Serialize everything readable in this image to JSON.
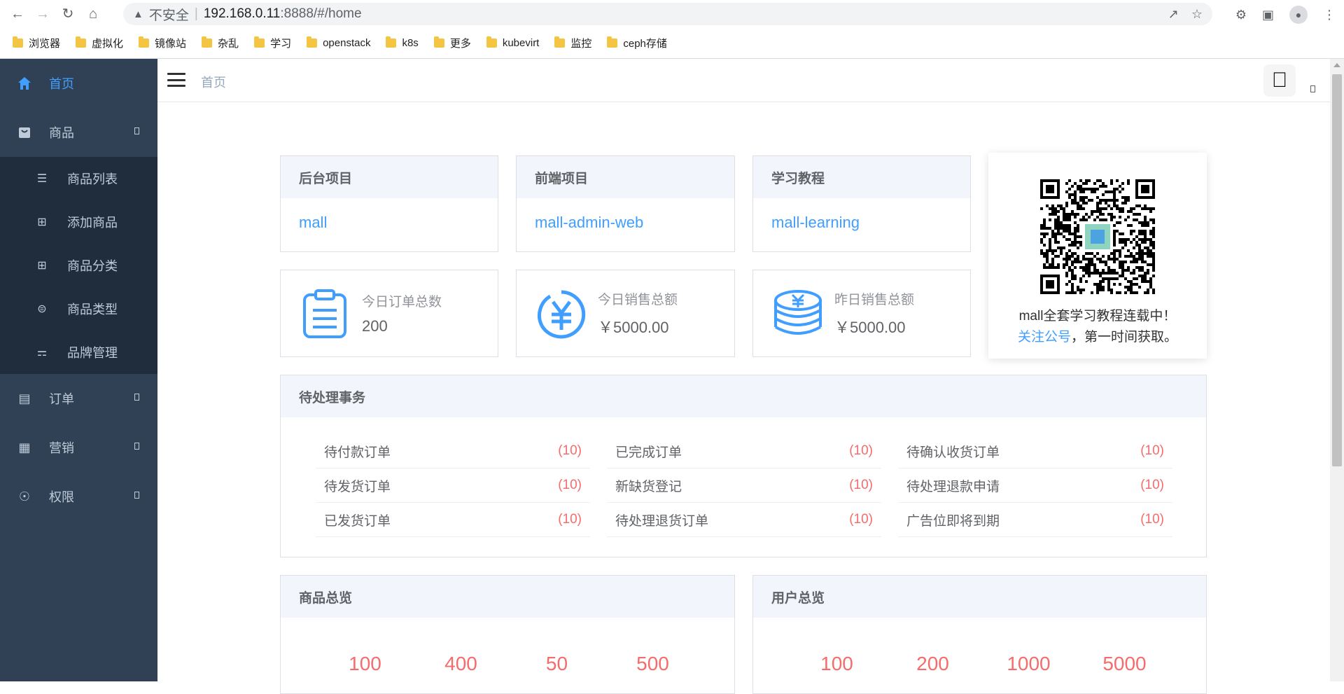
{
  "browser": {
    "insecure_label": "不安全",
    "url_host": "192.168.0.11",
    "url_rest": ":8888/#/home",
    "bookmarks": [
      "浏览器",
      "虚拟化",
      "镜像站",
      "杂乱",
      "学习",
      "openstack",
      "k8s",
      "更多",
      "kubevirt",
      "监控",
      "ceph存储"
    ]
  },
  "sidebar": {
    "home": "首页",
    "product": "商品",
    "product_sub": [
      "商品列表",
      "添加商品",
      "商品分类",
      "商品类型",
      "品牌管理"
    ],
    "order": "订单",
    "marketing": "营销",
    "permission": "权限"
  },
  "header": {
    "breadcrumb": "首页"
  },
  "projects": [
    {
      "title": "后台项目",
      "link": "mall"
    },
    {
      "title": "前端项目",
      "link": "mall-admin-web"
    },
    {
      "title": "学习教程",
      "link": "mall-learning"
    }
  ],
  "stats": [
    {
      "label": "今日订单总数",
      "value": "200",
      "icon": "clipboard-icon"
    },
    {
      "label": "今日销售总额",
      "value": "￥5000.00",
      "icon": "yuan-icon"
    },
    {
      "label": "昨日销售总额",
      "value": "￥5000.00",
      "icon": "coins-icon"
    }
  ],
  "qr": {
    "line1": "mall全套学习教程连载中！",
    "link": "关注公号",
    "line2_rest": "，第一时间获取。"
  },
  "todo": {
    "title": "待处理事务",
    "items": [
      {
        "label": "待付款订单",
        "count": "(10)"
      },
      {
        "label": "已完成订单",
        "count": "(10)"
      },
      {
        "label": "待确认收货订单",
        "count": "(10)"
      },
      {
        "label": "待发货订单",
        "count": "(10)"
      },
      {
        "label": "新缺货登记",
        "count": "(10)"
      },
      {
        "label": "待处理退款申请",
        "count": "(10)"
      },
      {
        "label": "已发货订单",
        "count": "(10)"
      },
      {
        "label": "待处理退货订单",
        "count": "(10)"
      },
      {
        "label": "广告位即将到期",
        "count": "(10)"
      }
    ]
  },
  "product_overview": {
    "title": "商品总览",
    "values": [
      "100",
      "400",
      "50",
      "500"
    ]
  },
  "user_overview": {
    "title": "用户总览",
    "values": [
      "100",
      "200",
      "1000",
      "5000"
    ]
  }
}
